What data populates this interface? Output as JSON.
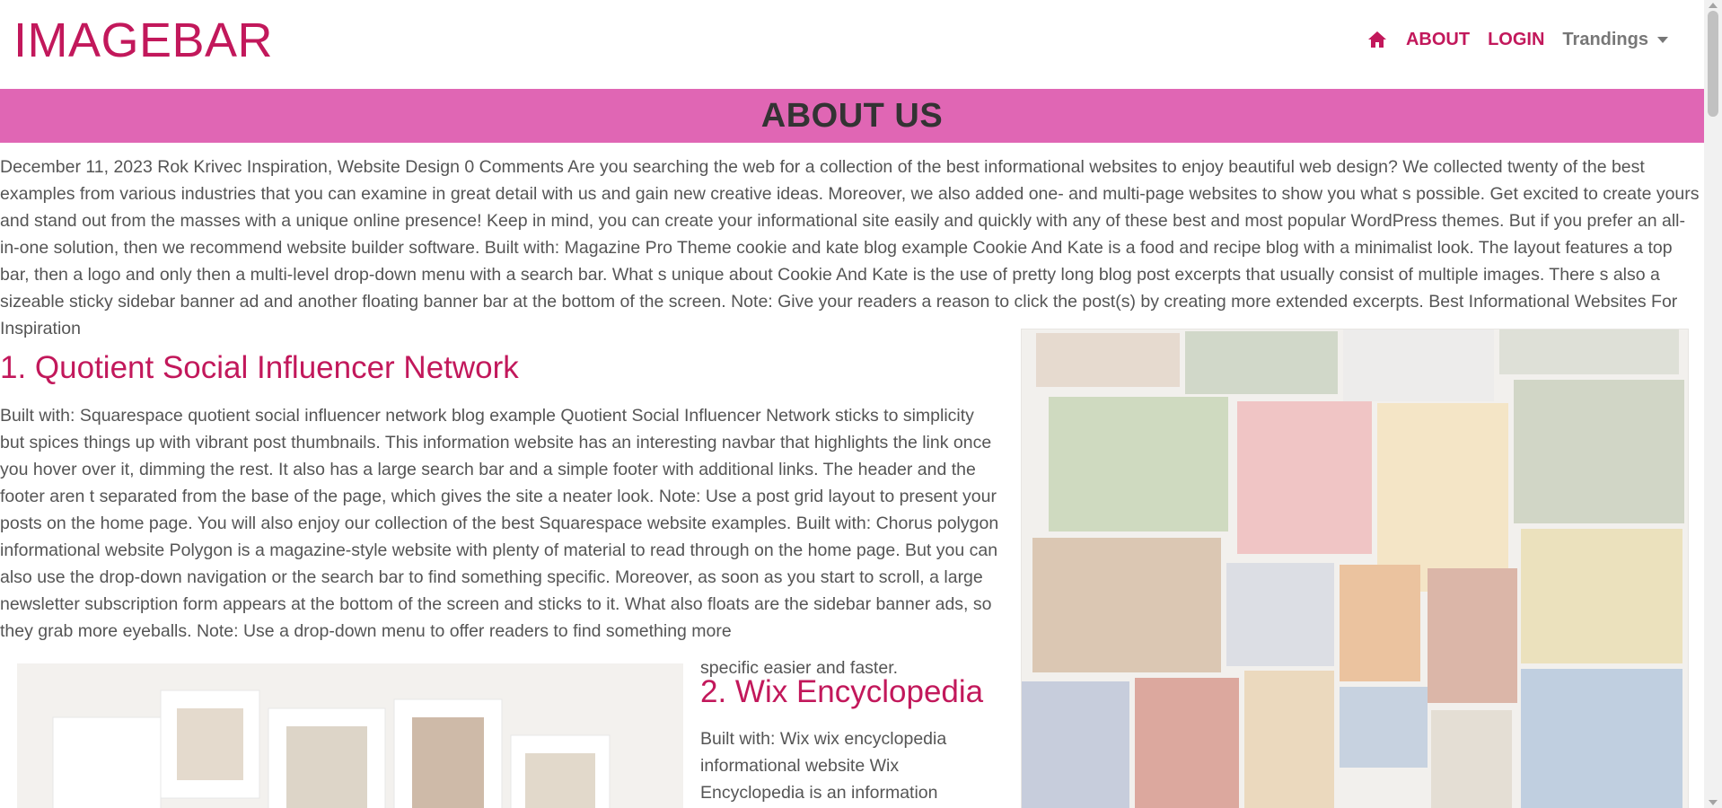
{
  "brand": "IMAGEBAR",
  "nav": {
    "home_icon": "home-icon",
    "about": "ABOUT",
    "login": "LOGIN",
    "dropdown": "Trandings"
  },
  "banner_title": "ABOUT US",
  "intro_text": "December 11, 2023 Rok Krivec Inspiration, Website Design 0 Comments Are you searching the web for a collection of the best informational websites to enjoy beautiful web design? We collected twenty of the best examples from various industries that you can examine in great detail with us and gain new creative ideas. Moreover, we also added one- and multi-page websites to show you what s possible. Get excited to create yours and stand out from the masses with a unique online presence! Keep in mind, you can create your informational site easily and quickly with any of these best and most popular WordPress themes. But if you prefer an all-in-one solution, then we recommend website builder software. Built with: Magazine Pro Theme cookie and kate blog example Cookie And Kate is a food and recipe blog with a minimalist look. The layout features a top bar, then a logo and only then a multi-level drop-down menu with a search bar. What s unique about Cookie And Kate is the use of pretty long blog post excerpts that usually consist of multiple images. There s also a sizeable sticky sidebar banner ad and another floating banner bar at the bottom of the screen. Note: Give your readers a reason to click the post(s) by creating more extended excerpts. Best Informational Websites For Inspiration",
  "section1": {
    "heading": "1. Quotient Social Influencer Network",
    "text": "Built with: Squarespace quotient social influencer network blog example Quotient Social Influencer Network sticks to simplicity but spices things up with vibrant post thumbnails. This information website has an interesting navbar that highlights the link once you hover over it, dimming the rest. It also has a large search bar and a simple footer with additional links. The header and the footer aren t separated from the base of the page, which gives the site a neater look. Note: Use a post grid layout to present your posts on the home page. You will also enjoy our collection of the best Squarespace website examples. Built with: Chorus polygon informational website Polygon is a magazine-style website with plenty of material to read through on the home page. But you can also use the drop-down navigation or the search bar to find something specific. Moreover, as soon as you start to scroll, a large newsletter subscription form appears at the bottom of the screen and sticks to it. What also floats are the sidebar banner ads, so they grab more eyeballs. Note: Use a drop-down menu to offer readers to find something more",
    "tail": "specific easier and faster."
  },
  "section2": {
    "heading": "2. Wix Encyclopedia",
    "text": "Built with: Wix wix encyclopedia informational website Wix Encyclopedia is an information"
  },
  "images": {
    "right": "paintings-collage",
    "left": "photo-prints-collage"
  },
  "colors": {
    "brand": "#c2185b",
    "banner": "#e066b4"
  }
}
